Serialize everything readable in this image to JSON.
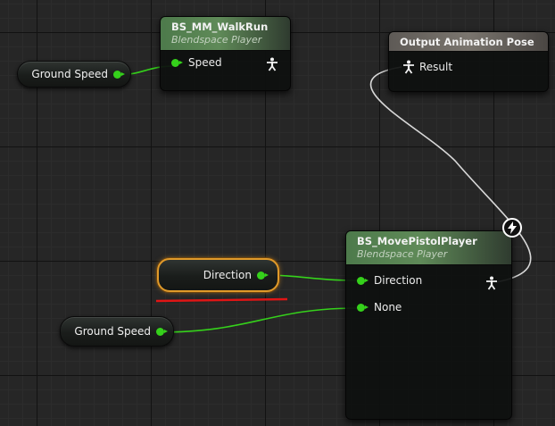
{
  "nodes": {
    "walkrun": {
      "title": "BS_MM_WalkRun",
      "subtitle": "Blendspace Player",
      "pin_speed": "Speed"
    },
    "output_pose": {
      "title": "Output Animation Pose",
      "pin_result": "Result"
    },
    "movepistol": {
      "title": "BS_MovePistolPlayer",
      "subtitle": "Blendspace Player",
      "pin_direction": "Direction",
      "pin_none": "None"
    }
  },
  "variables": {
    "ground_speed_top": "Ground Speed",
    "direction": "Direction",
    "ground_speed_bottom": "Ground Speed"
  },
  "colors": {
    "float_pin": "#35d11b",
    "selection": "#e09a2a",
    "annotation_underline": "#e01515",
    "pose_wire": "#d8d8d8"
  },
  "icons": [
    "pose-pin-icon",
    "pose-output-icon",
    "reroute-bolt-icon"
  ]
}
